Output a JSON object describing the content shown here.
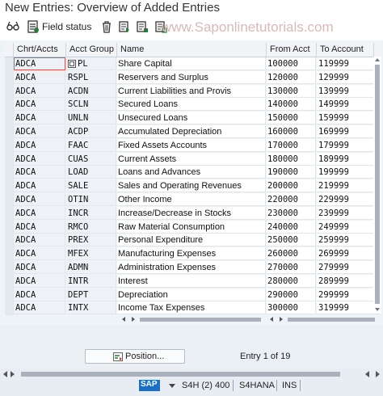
{
  "window": {
    "title": "New Entries: Overview of Added Entries"
  },
  "toolbar": {
    "field_status_label": "Field status"
  },
  "watermarks": [
    "www.Saponlinetutorials.com",
    "www.Saponlinetutorials.com"
  ],
  "table": {
    "columns": [
      "Chrt/Accts",
      "Acct Group",
      "Name",
      "From Acct",
      "To Account"
    ],
    "rows": [
      {
        "chrt": "ADCA",
        "grp": "PL",
        "name": "Share Capital",
        "from": "100000",
        "to": "119999"
      },
      {
        "chrt": "ADCA",
        "grp": "RSPL",
        "name": "Reservers and Surplus",
        "from": "120000",
        "to": "129999"
      },
      {
        "chrt": "ADCA",
        "grp": "ACDN",
        "name": "Current Liabilities and Provis",
        "from": "130000",
        "to": "139999"
      },
      {
        "chrt": "ADCA",
        "grp": "SCLN",
        "name": "Secured Loans",
        "from": "140000",
        "to": "149999"
      },
      {
        "chrt": "ADCA",
        "grp": "UNLN",
        "name": "Unsecured Loans",
        "from": "150000",
        "to": "159999"
      },
      {
        "chrt": "ADCA",
        "grp": "ACDP",
        "name": "Accumulated Depreciation",
        "from": "160000",
        "to": "169999"
      },
      {
        "chrt": "ADCA",
        "grp": "FAAC",
        "name": "Fixed Assets Accounts",
        "from": "170000",
        "to": "179999"
      },
      {
        "chrt": "ADCA",
        "grp": "CUAS",
        "name": "Current Assets",
        "from": "180000",
        "to": "189999"
      },
      {
        "chrt": "ADCA",
        "grp": "LOAD",
        "name": "Loans and Advances",
        "from": "190000",
        "to": "199999"
      },
      {
        "chrt": "ADCA",
        "grp": "SALE",
        "name": "Sales and Operating Revenues",
        "from": "200000",
        "to": "219999"
      },
      {
        "chrt": "ADCA",
        "grp": "OTIN",
        "name": "Other Income",
        "from": "220000",
        "to": "229999"
      },
      {
        "chrt": "ADCA",
        "grp": "INCR",
        "name": "Increase/Decrease in Stocks",
        "from": "230000",
        "to": "239999"
      },
      {
        "chrt": "ADCA",
        "grp": "RMCO",
        "name": "Raw Material Consumption",
        "from": "240000",
        "to": "249999"
      },
      {
        "chrt": "ADCA",
        "grp": "PREX",
        "name": "Personal Expenditure",
        "from": "250000",
        "to": "259999"
      },
      {
        "chrt": "ADCA",
        "grp": "MFEX",
        "name": "Manufacturing Expenses",
        "from": "260000",
        "to": "269999"
      },
      {
        "chrt": "ADCA",
        "grp": "ADMN",
        "name": "Administration Expenses",
        "from": "270000",
        "to": "279999"
      },
      {
        "chrt": "ADCA",
        "grp": "INTR",
        "name": "Interest",
        "from": "280000",
        "to": "289999"
      },
      {
        "chrt": "ADCA",
        "grp": "DEPT",
        "name": "Depreciation",
        "from": "290000",
        "to": "299999"
      },
      {
        "chrt": "ADCA",
        "grp": "INTX",
        "name": "Income Tax Expenses",
        "from": "300000",
        "to": "319999"
      }
    ]
  },
  "footer": {
    "position_button_label": "Position...",
    "entry_text": "Entry 1 of 19"
  },
  "status_bar": {
    "logo_text": "SAP",
    "system": "S4H (2) 400",
    "server": "S4HANA",
    "mode": "INS"
  },
  "colors": {
    "sap_blue": "#1a6fc4",
    "table_bg": "#eef3f8"
  }
}
